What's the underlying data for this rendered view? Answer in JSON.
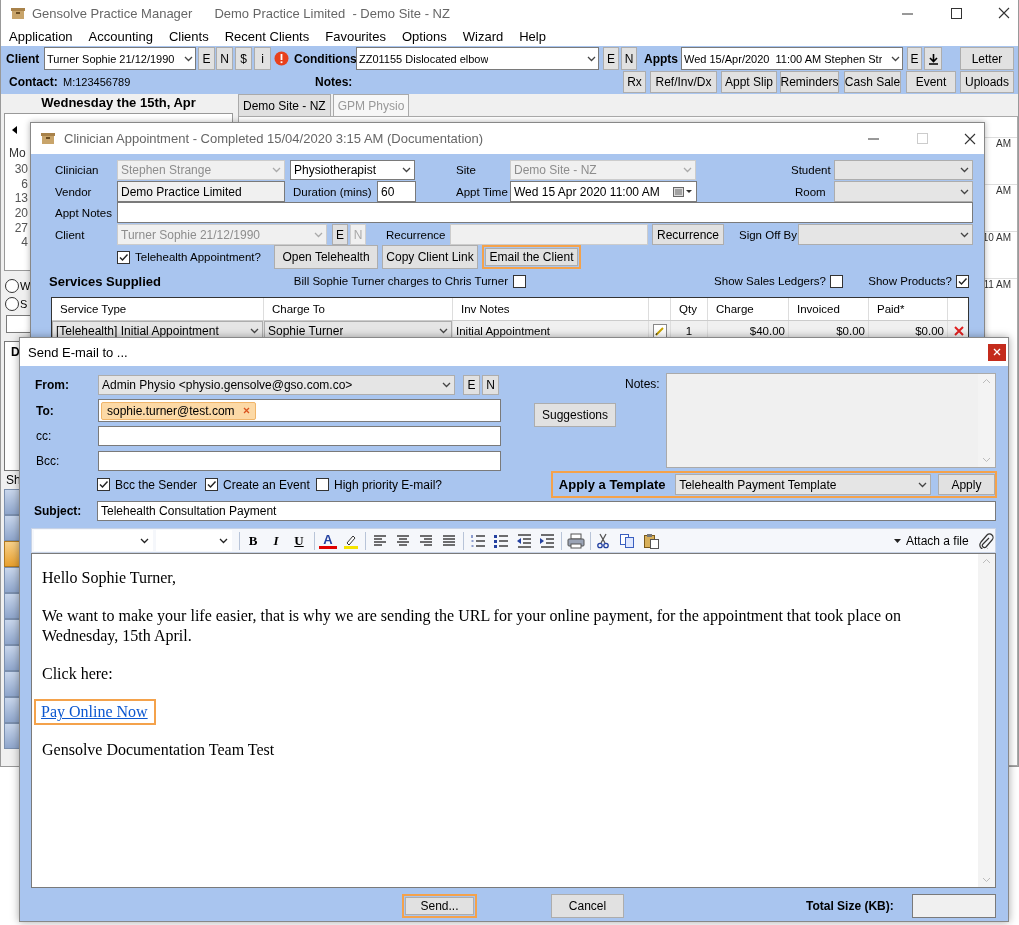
{
  "app_window": {
    "title": "Gensolve Practice Manager",
    "context": "Demo Practice Limited  - Demo Site - NZ"
  },
  "menu": [
    "Application",
    "Accounting",
    "Clients",
    "Recent Clients",
    "Favourites",
    "Options",
    "Wizard",
    "Help"
  ],
  "client_bar": {
    "client_label": "Client",
    "client": "Turner Sophie 21/12/1990",
    "client_buttons": [
      "E",
      "N",
      "$",
      "i"
    ],
    "conditions_label": "Conditions",
    "condition": "ZZ01155 Dislocated elbow",
    "condition_buttons": [
      "E",
      "N"
    ],
    "appts_label": "Appts",
    "appointment": "Wed 15/Apr/2020  11:00 AM Stephen Str",
    "appointment_buttons": [
      "E"
    ],
    "letter_button": "Letter",
    "contact_label": "Contact:",
    "contact": "M:123456789",
    "notes_label": "Notes:",
    "action_buttons": [
      "Rx",
      "Ref/Inv/Dx",
      "Appt Slip",
      "Reminders",
      "Cash Sale",
      "Event",
      "Uploads"
    ]
  },
  "calendar": {
    "heading": "Wednesday the 15th, Apr",
    "weekday": "Mo",
    "dates": [
      "30",
      "6",
      "13",
      "20",
      "27",
      "4"
    ],
    "view_options": [
      {
        "label": "W",
        "selected": false
      },
      {
        "label": "S",
        "selected": false
      }
    ],
    "list_heading": "D",
    "footer": "Sh",
    "slot_buttons": [
      {
        "selected": false
      },
      {
        "selected": false
      },
      {
        "selected": true
      },
      {
        "selected": false
      },
      {
        "selected": false
      },
      {
        "selected": false
      },
      {
        "selected": false
      },
      {
        "selected": false
      },
      {
        "selected": false
      },
      {
        "selected": false
      }
    ]
  },
  "tabs": [
    {
      "label": "Demo Site - NZ",
      "selected": true
    },
    {
      "label": "GPM Physio",
      "selected": false
    }
  ],
  "time_labels": [
    "AM",
    "AM",
    "10 AM",
    "11 AM"
  ],
  "clinician_dialog": {
    "title": "Clinician Appointment - Completed 15/04/2020 3:15 AM (Documentation)",
    "clinician_label": "Clinician",
    "clinician": {
      "value": "Stephen Strange",
      "disabled": true
    },
    "role": "Physiotherapist",
    "site_label": "Site",
    "site": {
      "value": "Demo Site - NZ",
      "disabled": true
    },
    "student_label": "Student",
    "vendor_label": "Vendor",
    "vendor": "Demo Practice Limited",
    "duration_label": "Duration (mins)",
    "duration": "60",
    "appt_time_label": "Appt Time",
    "appt_time": "Wed 15  Apr  2020 11:00 AM",
    "room_label": "Room",
    "appt_notes_label": "Appt Notes",
    "client_label": "Client",
    "client": {
      "value": "Turner Sophie 21/12/1990",
      "disabled": true
    },
    "client_buttons": [
      {
        "label": "E",
        "disabled": false
      },
      {
        "label": "N",
        "disabled": true
      }
    ],
    "recurrence_label": "Recurrence",
    "recurrence_button": "Recurrence",
    "sign_off_label": "Sign Off By",
    "telehealth": {
      "label": "Telehealth Appointment?",
      "checked": true
    },
    "actions": [
      {
        "label": "Open Telehealth",
        "highlighted": false
      },
      {
        "label": "Copy Client Link",
        "highlighted": false
      },
      {
        "label": "Email the Client",
        "highlighted": true
      }
    ],
    "services_heading": "Services Supplied",
    "options": [
      {
        "label": "Bill Sophie Turner charges to Chris Turner",
        "checked": false
      },
      {
        "label": "Show Sales Ledgers?",
        "checked": false
      },
      {
        "label": "Show Products?",
        "checked": true
      }
    ],
    "table": {
      "columns": [
        "Service Type",
        "Charge To",
        "Inv Notes",
        "Qty",
        "Charge",
        "Invoiced",
        "Paid*"
      ],
      "rows": [
        {
          "service_type": "[Telehealth] Initial Appointment",
          "charge_to": "Sophie Turner",
          "inv_notes": "Initial Appointment",
          "qty": "1",
          "charge": "$40.00",
          "invoiced": "$0.00",
          "paid": "$0.00"
        }
      ]
    }
  },
  "email_dialog": {
    "title": "Send E-mail to ...",
    "from_label": "From:",
    "from": "Admin Physio <physio.gensolve@gso.com.co>",
    "from_buttons": [
      "E",
      "N"
    ],
    "to_label": "To:",
    "recipients": [
      "sophie.turner@test.com"
    ],
    "cc_label": "cc:",
    "bcc_label": "Bcc:",
    "suggestions_button": "Suggestions",
    "notes_label": "Notes:",
    "options": [
      {
        "label": "Bcc the Sender",
        "checked": true
      },
      {
        "label": "Create an Event",
        "checked": true
      },
      {
        "label": "High priority E-mail?",
        "checked": false
      }
    ],
    "template": {
      "label": "Apply a Template",
      "value": "Telehealth Payment Template",
      "button": "Apply",
      "highlighted": true
    },
    "subject_label": "Subject:",
    "subject": "Telehealth Consultation Payment",
    "format_buttons": [
      "B",
      "I",
      "U"
    ],
    "font_color_button": "A",
    "attach": "Attach a file",
    "body": [
      {
        "kind": "text",
        "text": "Hello Sophie Turner,"
      },
      {
        "kind": "text",
        "text": "We want to make your life easier, that is why we are sending the URL for your online payment, for the appointment that took place on Wednesday, 15th April."
      },
      {
        "kind": "text",
        "text": "Click here:"
      },
      {
        "kind": "link",
        "text": "Pay Online Now",
        "highlighted": true
      },
      {
        "kind": "text",
        "text": "Gensolve Documentation Team Test"
      }
    ],
    "send_button": {
      "label": "Send...",
      "highlighted": true
    },
    "cancel_button": "Cancel",
    "total_size_label": "Total Size (KB):"
  }
}
